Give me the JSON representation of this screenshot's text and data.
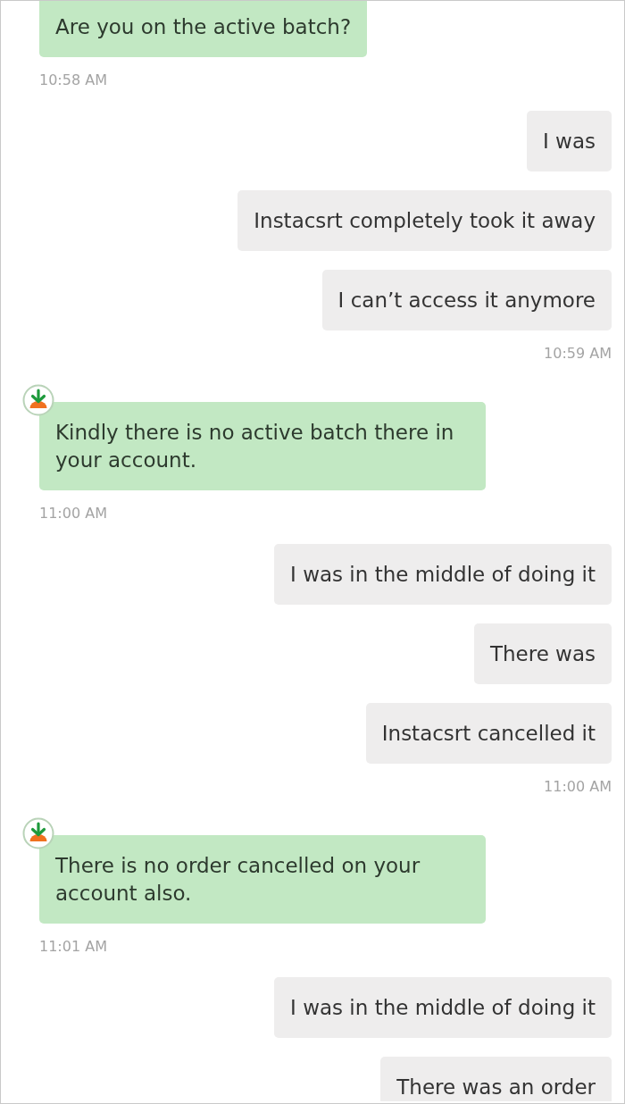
{
  "groups": [
    {
      "kind": "agent",
      "bubbles": [
        "Are you on the active batch?"
      ],
      "time": "10:58 AM"
    },
    {
      "kind": "user",
      "bubbles": [
        "I was",
        "Instacsrt completely took it away",
        "I can’t access it anymore"
      ],
      "time": "10:59 AM"
    },
    {
      "kind": "agent",
      "avatar": true,
      "bubbles": [
        "Kindly there is no active batch there in your account."
      ],
      "time": "11:00 AM"
    },
    {
      "kind": "user",
      "bubbles": [
        "I was in the middle of doing it",
        "There was",
        "Instacsrt cancelled it"
      ],
      "time": "11:00 AM"
    },
    {
      "kind": "agent",
      "avatar": true,
      "bubbles": [
        "There is no order cancelled on your account also."
      ],
      "time": "11:01 AM"
    },
    {
      "kind": "user",
      "bubbles": [
        "I was in the middle of doing it",
        "There was an order"
      ]
    }
  ]
}
